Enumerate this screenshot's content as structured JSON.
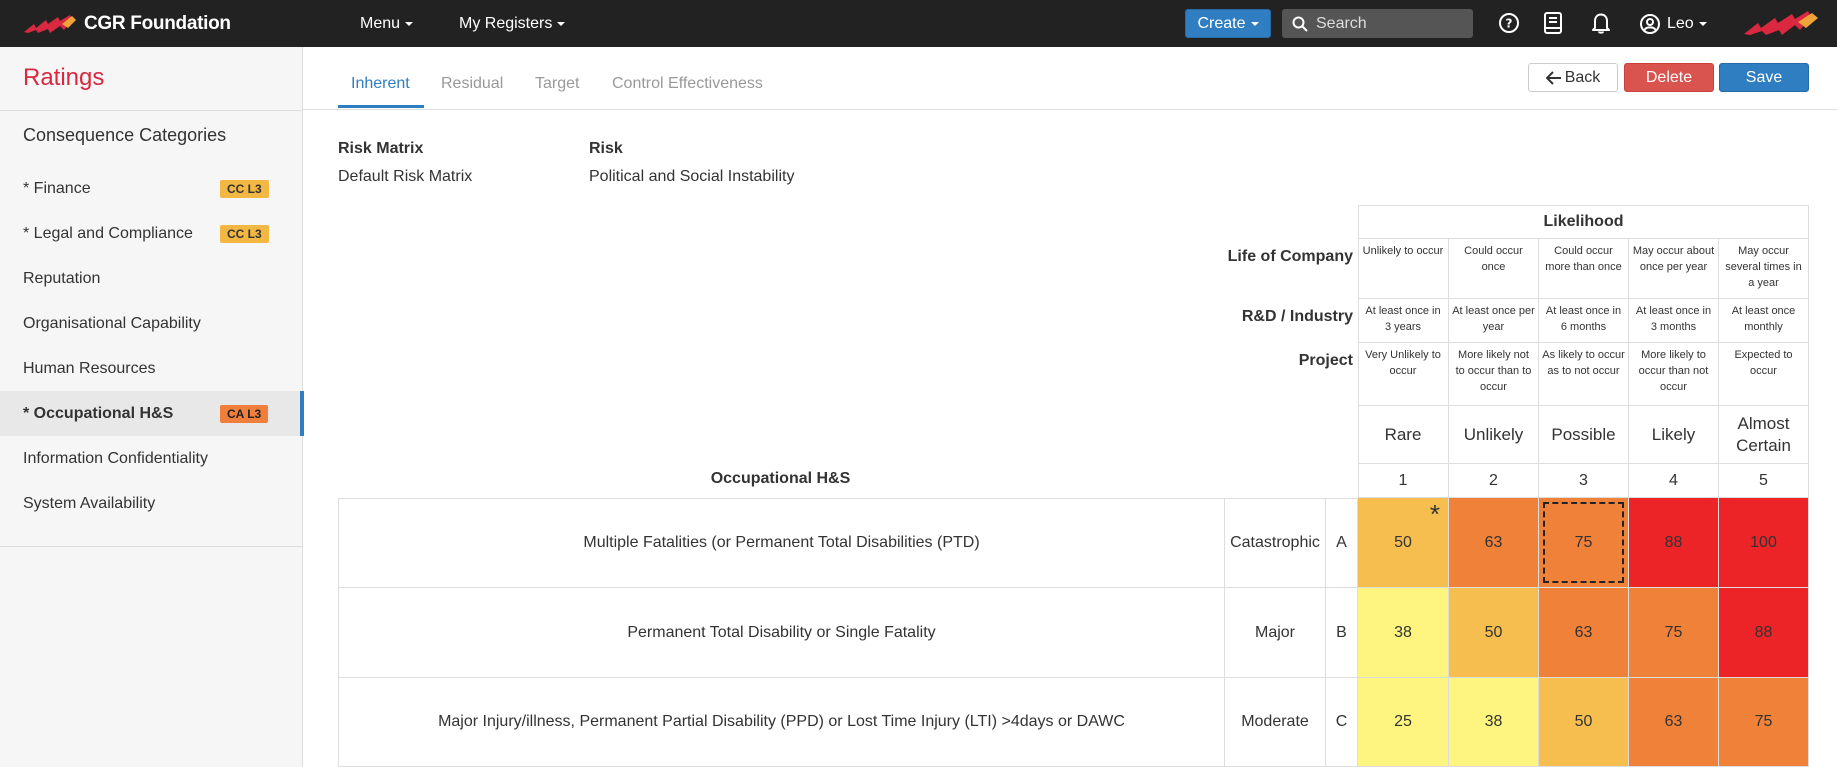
{
  "navbar": {
    "brand": "CGR Foundation",
    "menu_label": "Menu",
    "registers_label": "My Registers",
    "create_label": "Create",
    "search_placeholder": "Search",
    "user_name": "Leo",
    "brand_color": "#d9283f"
  },
  "sidebar": {
    "title": "Ratings",
    "section_title": "Consequence Categories",
    "items": [
      {
        "label": "* Finance",
        "badge": "CC L3"
      },
      {
        "label": "* Legal and Compliance",
        "badge": "CC L3"
      },
      {
        "label": "Reputation",
        "badge": ""
      },
      {
        "label": "Organisational Capability",
        "badge": ""
      },
      {
        "label": "Human Resources",
        "badge": ""
      },
      {
        "label": "* Occupational H&S",
        "badge": "CA L3"
      },
      {
        "label": "Information Confidentiality",
        "badge": ""
      },
      {
        "label": "System Availability",
        "badge": ""
      }
    ]
  },
  "tabs": [
    {
      "label": "Inherent"
    },
    {
      "label": "Residual"
    },
    {
      "label": "Target"
    },
    {
      "label": "Control Effectiveness"
    }
  ],
  "actions": {
    "back_label": "Back",
    "delete_label": "Delete",
    "save_label": "Save"
  },
  "info": {
    "matrix_label": "Risk Matrix",
    "matrix_value": "Default Risk Matrix",
    "risk_label": "Risk",
    "risk_value": "Political and Social Instability"
  },
  "likelihood": {
    "title": "Likelihood",
    "row_labels": [
      "Life of Company",
      "R&D / Industry",
      "Project"
    ],
    "life_of_company": [
      "Unlikely to occur",
      "Could occur once",
      "Could occur more than once",
      "May occur about once per year",
      "May occur several times in a year"
    ],
    "rd_industry": [
      "At least once in 3 years",
      "At least once per year",
      "At least once in 6 months",
      "At least once in 3 months",
      "At least once monthly"
    ],
    "project": [
      "Very Unlikely to occur",
      "More likely not to occur than to occur",
      "As likely to occur as to not occur",
      "More likely to occur than not occur",
      "Expected to occur"
    ],
    "names": [
      "Rare",
      "Unlikely",
      "Possible",
      "Likely",
      "Almost Certain"
    ],
    "numbers": [
      "1",
      "2",
      "3",
      "4",
      "5"
    ]
  },
  "consequence": {
    "category_title": "Occupational H&S",
    "rows": [
      {
        "description": "Multiple Fatalities (or Permanent Total Disabilities (PTD)",
        "name": "Catastrophic",
        "letter": "A",
        "values": [
          "50",
          "63",
          "75",
          "88",
          "100"
        ],
        "colors": [
          "amber",
          "orange",
          "orange",
          "red",
          "red"
        ]
      },
      {
        "description": "Permanent Total Disability or Single Fatality",
        "name": "Major",
        "letter": "B",
        "values": [
          "38",
          "50",
          "63",
          "75",
          "88"
        ],
        "colors": [
          "yellow",
          "amber",
          "orange",
          "orange",
          "red"
        ]
      },
      {
        "description": "Major Injury/illness, Permanent Partial Disability (PPD) or Lost Time Injury (LTI) >4days or DAWC",
        "name": "Moderate",
        "letter": "C",
        "values": [
          "25",
          "38",
          "50",
          "63",
          "75"
        ],
        "colors": [
          "yellow",
          "yellow",
          "amber",
          "orange",
          "orange"
        ]
      }
    ],
    "selected_cell": "A3",
    "marked_cell": "A1",
    "marker": "*"
  }
}
